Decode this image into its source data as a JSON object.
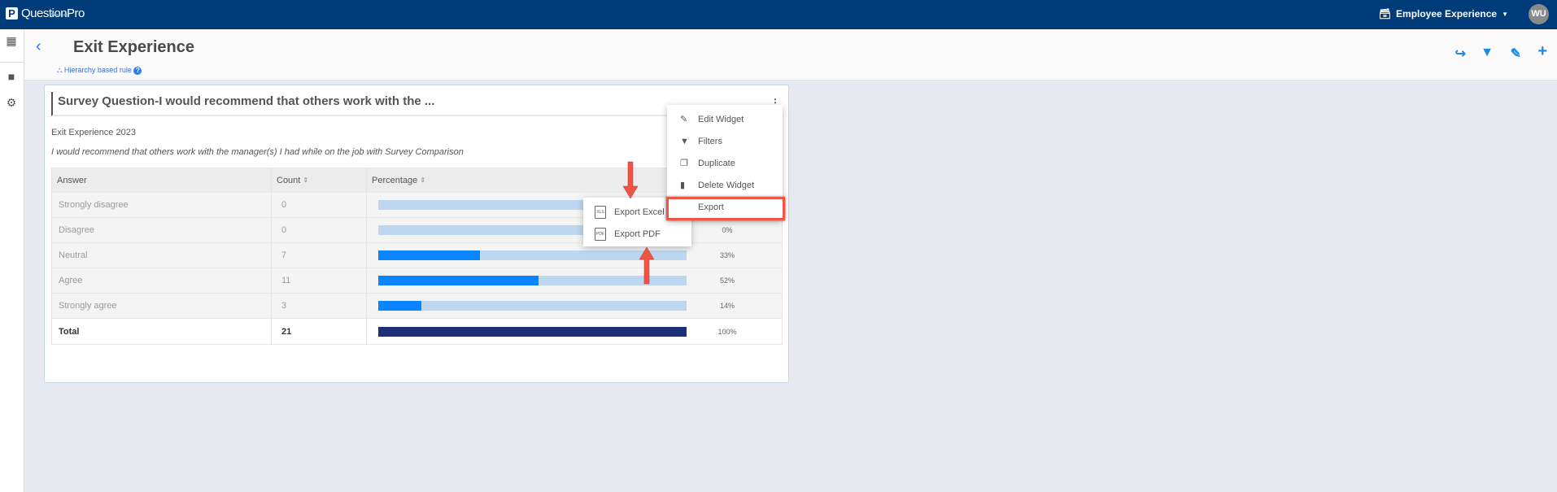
{
  "app": {
    "logo": "QuestionPro",
    "logo_sub": "Workforce",
    "product": "Employee Experience",
    "avatar": "WU"
  },
  "header": {
    "title": "Exit Experience",
    "rule": "Hierarchy based rule"
  },
  "widget": {
    "title": "Survey Question-I would recommend that others work with the ...",
    "survey": "Exit Experience 2023",
    "question": "I would recommend that others work with the manager(s) I had while on the job with Survey Comparison",
    "columns": [
      "Answer",
      "Count",
      "Percentage"
    ],
    "rows": [
      {
        "answer": "Strongly disagree",
        "count": "0",
        "percent": "0%",
        "value": 0
      },
      {
        "answer": "Disagree",
        "count": "0",
        "percent": "0%",
        "value": 0
      },
      {
        "answer": "Neutral",
        "count": "7",
        "percent": "33%",
        "value": 33
      },
      {
        "answer": "Agree",
        "count": "11",
        "percent": "52%",
        "value": 52
      },
      {
        "answer": "Strongly agree",
        "count": "3",
        "percent": "14%",
        "value": 14
      }
    ],
    "total": {
      "answer": "Total",
      "count": "21",
      "percent": "100%",
      "value": 100
    }
  },
  "menu": [
    "Edit Widget",
    "Filters",
    "Duplicate",
    "Delete Widget",
    "Export"
  ],
  "submenu": [
    {
      "label": "Export Excel",
      "icon": "XLS"
    },
    {
      "label": "Export PDF",
      "icon": "PDF"
    }
  ],
  "colors": {
    "topbar": "#003b7a",
    "bar_fill": "#0a84ff",
    "bar_bg": "#bdd7f0",
    "total_bar": "#1c307a",
    "highlight": "#f05544"
  }
}
